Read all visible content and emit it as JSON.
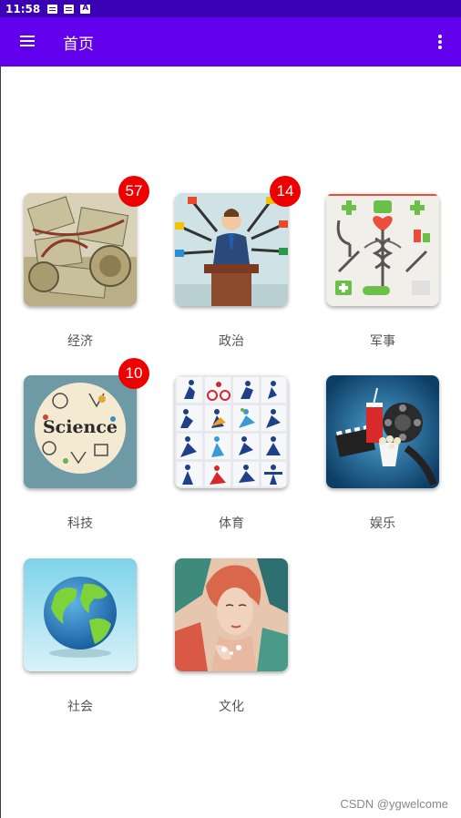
{
  "status_bar": {
    "time": "11:58",
    "icons": [
      "message-icon",
      "message-icon",
      "a-icon"
    ]
  },
  "app_bar": {
    "title": "首页",
    "menu_icon": "hamburger-menu-icon",
    "overflow_icon": "more-vert-icon",
    "color": "#6200ee"
  },
  "tiles": [
    {
      "label": "经济",
      "badge": "57",
      "image": "money-rolls-image"
    },
    {
      "label": "政治",
      "badge": "14",
      "image": "politician-podium-image"
    },
    {
      "label": "军事",
      "badge": "",
      "image": "medical-icons-image"
    },
    {
      "label": "科技",
      "badge": "10",
      "image": "science-doodle-image"
    },
    {
      "label": "体育",
      "badge": "",
      "image": "sports-pictograms-image"
    },
    {
      "label": "娱乐",
      "badge": "",
      "image": "cinema-film-image"
    },
    {
      "label": "社会",
      "badge": "",
      "image": "globe-image"
    },
    {
      "label": "文化",
      "badge": "",
      "image": "art-portrait-image"
    }
  ],
  "science_text": "Science",
  "watermark": "CSDN @ygwelcome",
  "badge_color": "#ee0000"
}
